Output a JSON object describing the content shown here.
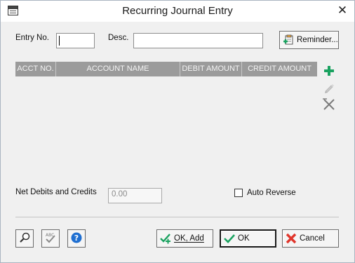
{
  "window": {
    "title": "Recurring Journal Entry",
    "close_glyph": "✕"
  },
  "form": {
    "entry_no_label": "Entry No.",
    "entry_no_value": "",
    "desc_label": "Desc.",
    "desc_value": "",
    "reminder_label": "Reminder..."
  },
  "grid": {
    "columns": [
      "ACCT NO.",
      "ACCOUNT NAME",
      "DEBIT AMOUNT",
      "CREDIT AMOUNT"
    ],
    "rows": []
  },
  "tools": {
    "add_icon": "plus-icon",
    "edit_icon": "pencil-icon",
    "delete_icon": "delete-x-icon"
  },
  "totals": {
    "net_label": "Net Debits and Credits",
    "net_placeholder": "0.00"
  },
  "auto_reverse": {
    "label": "Auto Reverse",
    "checked": false
  },
  "footer": {
    "ok_add_label": "OK, Add",
    "ok_label": "OK",
    "cancel_label": "Cancel"
  },
  "colors": {
    "grid_header_bg": "#9b9b9b",
    "accent_green": "#1aa260",
    "cancel_red": "#e0352b",
    "help_blue": "#1f6fd1"
  }
}
